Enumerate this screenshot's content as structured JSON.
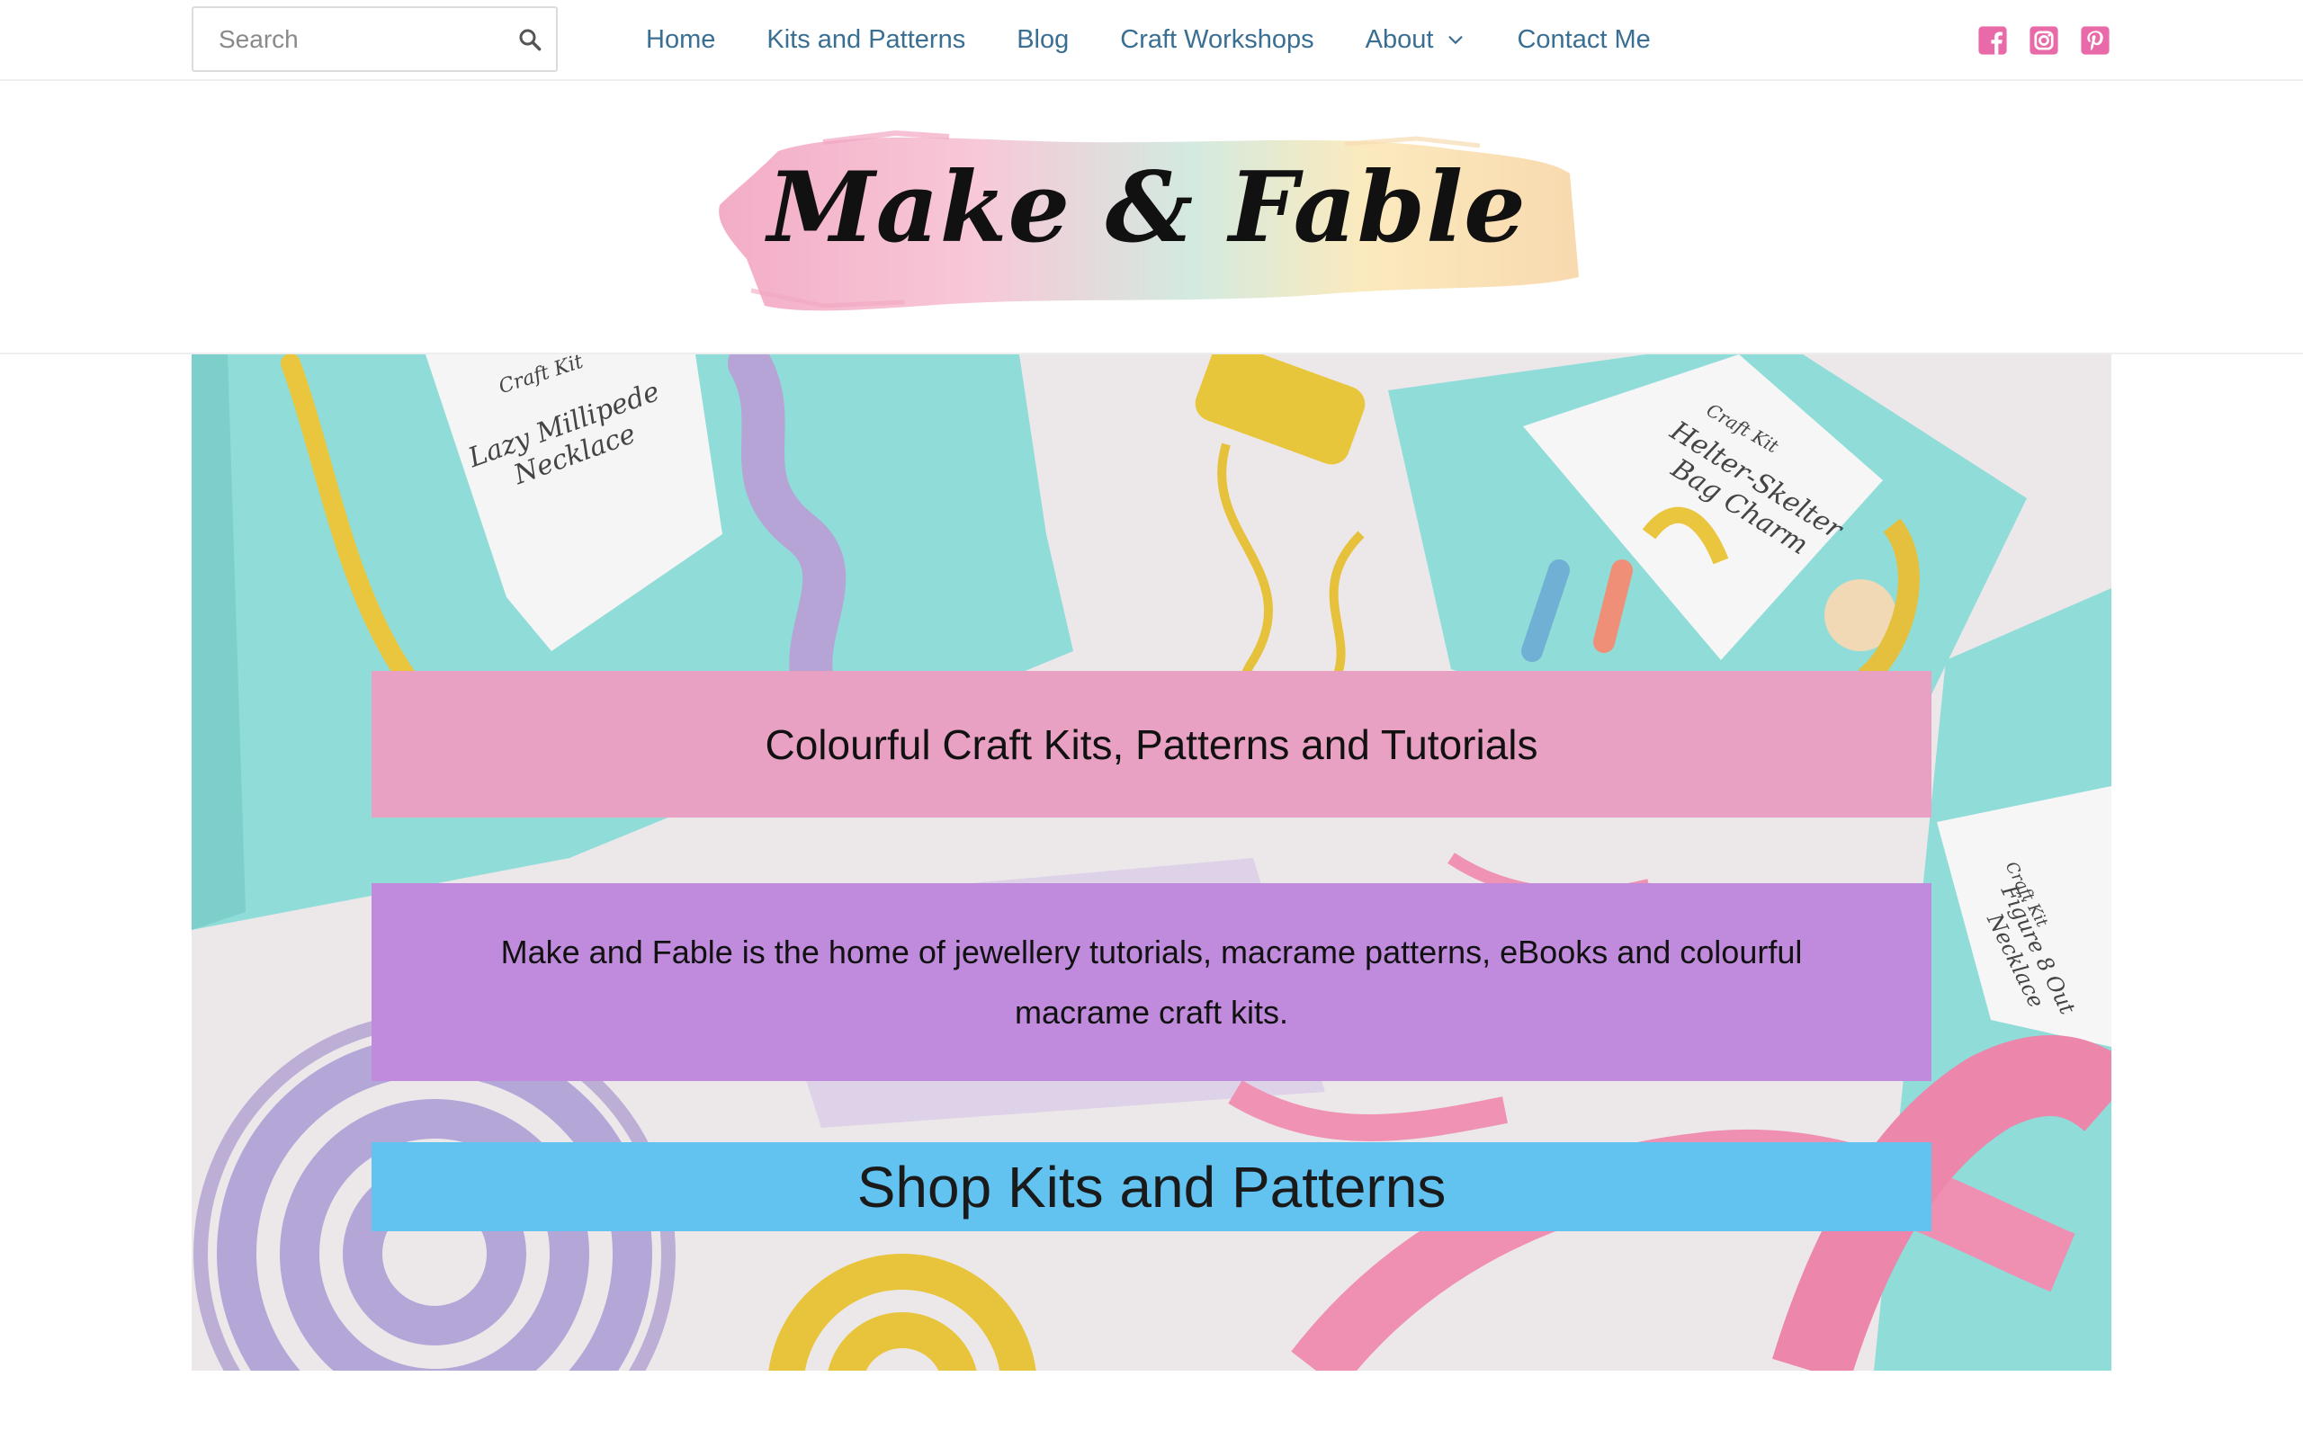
{
  "search": {
    "placeholder": "Search",
    "value": ""
  },
  "nav": {
    "items": [
      {
        "label": "Home"
      },
      {
        "label": "Kits and Patterns"
      },
      {
        "label": "Blog"
      },
      {
        "label": "Craft Workshops"
      },
      {
        "label": "About",
        "has_dropdown": true
      },
      {
        "label": "Contact Me"
      }
    ]
  },
  "social": [
    {
      "icon": "facebook-icon",
      "color": "#e86aa8"
    },
    {
      "icon": "instagram-icon",
      "color": "#e86aa8"
    },
    {
      "icon": "pinterest-icon",
      "color": "#e86aa8"
    }
  ],
  "logo": {
    "text": "Make & Fable"
  },
  "hero": {
    "headline": "Colourful Craft Kits, Patterns and Tutorials",
    "description": "Make and Fable is the home of jewellery tutorials, macrame patterns, eBooks and colourful macrame craft kits.",
    "cta_label": "Shop Kits and Patterns",
    "image_cards": [
      {
        "top": "Craft Kit",
        "title": "Lazy Millipede Necklace"
      },
      {
        "top": "Craft Kit",
        "title": "Helter-Skelter Bag Charm"
      },
      {
        "top": "Craft Kit",
        "title": "Figure 8 Out Necklace"
      }
    ]
  },
  "colors": {
    "nav_link": "#3a6f93",
    "headline_banner": "#e8a1c2",
    "description_banner": "#c08bdc",
    "cta_banner": "#62c3f0",
    "social_icon": "#e86aa8"
  }
}
